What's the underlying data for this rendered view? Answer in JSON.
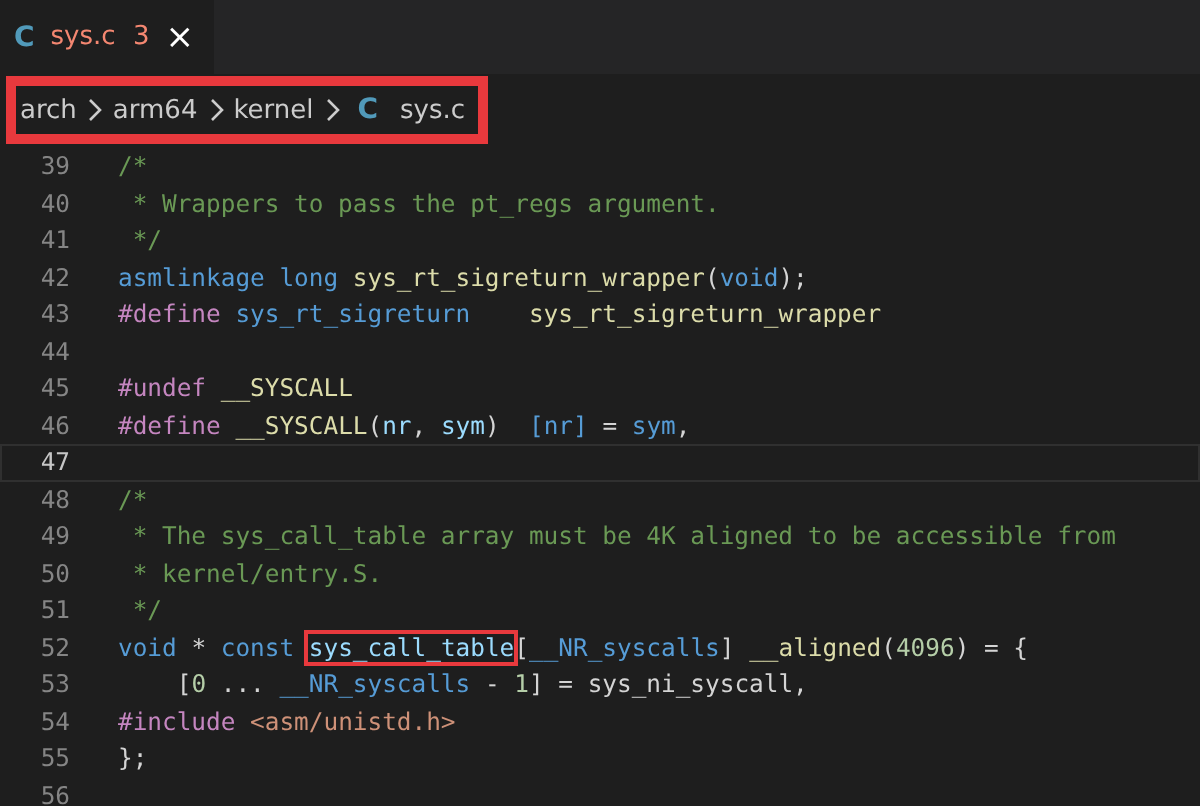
{
  "tab": {
    "icon": "C",
    "title": "sys.c",
    "problems": "3",
    "close": "×",
    "selected": true
  },
  "breadcrumb": {
    "highlighted": true,
    "items": [
      {
        "label": "arch"
      },
      {
        "label": "arm64"
      },
      {
        "label": "kernel"
      },
      {
        "label": "sys.c",
        "icon": "C"
      }
    ]
  },
  "lines": [
    {
      "number": "39",
      "current": false,
      "tokens": [
        {
          "text": "/*",
          "kind": "comment"
        }
      ]
    },
    {
      "number": "40",
      "current": false,
      "tokens": [
        {
          "text": " * Wrappers to pass the pt_regs argument.",
          "kind": "comment"
        }
      ]
    },
    {
      "number": "41",
      "current": false,
      "tokens": [
        {
          "text": " */",
          "kind": "comment"
        }
      ]
    },
    {
      "number": "42",
      "current": false,
      "tokens": [
        {
          "text": "asmlinkage long",
          "kind": "keyword"
        },
        {
          "text": " sys_rt_sigreturn_wrapper",
          "kind": "func"
        },
        {
          "text": "(",
          "kind": "plain"
        },
        {
          "text": "void",
          "kind": "keyword"
        },
        {
          "text": ");",
          "kind": "plain"
        }
      ]
    },
    {
      "number": "43",
      "current": false,
      "tokens": [
        {
          "text": "#define",
          "kind": "macro"
        },
        {
          "text": " sys_rt_sigreturn",
          "kind": "keyword"
        },
        {
          "text": "    sys_rt_sigreturn_wrapper",
          "kind": "func"
        }
      ]
    },
    {
      "number": "44",
      "current": false
    },
    {
      "number": "45",
      "current": false,
      "tokens": [
        {
          "text": "#undef",
          "kind": "macro"
        },
        {
          "text": " __SYSCALL",
          "kind": "func"
        }
      ]
    },
    {
      "number": "46",
      "current": false,
      "tokens": [
        {
          "text": "#define",
          "kind": "macro"
        },
        {
          "text": " __SYSCALL",
          "kind": "func"
        },
        {
          "text": "(",
          "kind": "plain"
        },
        {
          "text": "nr",
          "kind": "var"
        },
        {
          "text": ", ",
          "kind": "plain"
        },
        {
          "text": "sym",
          "kind": "var"
        },
        {
          "text": ")  ",
          "kind": "plain"
        },
        {
          "text": "[nr]",
          "kind": "keyword"
        },
        {
          "text": " = ",
          "kind": "plain"
        },
        {
          "text": "sym",
          "kind": "keyword"
        },
        {
          "text": ",",
          "kind": "plain"
        }
      ]
    },
    {
      "number": "47",
      "current": true
    },
    {
      "number": "48",
      "current": false,
      "tokens": [
        {
          "text": "/*",
          "kind": "comment"
        }
      ]
    },
    {
      "number": "49",
      "current": false,
      "tokens": [
        {
          "text": " * The sys_call_table array must be 4K aligned to be accessible from",
          "kind": "comment"
        }
      ]
    },
    {
      "number": "50",
      "current": false,
      "tokens": [
        {
          "text": " * kernel/entry.S.",
          "kind": "comment"
        }
      ]
    },
    {
      "number": "51",
      "current": false,
      "tokens": [
        {
          "text": " */",
          "kind": "comment"
        }
      ]
    },
    {
      "number": "52",
      "current": false,
      "tokens": [
        {
          "text": "void",
          "kind": "keyword"
        },
        {
          "text": " * ",
          "kind": "plain"
        },
        {
          "text": "const ",
          "kind": "keyword"
        },
        {
          "text": "sys_call_table",
          "kind": "var",
          "highlighted": true
        },
        {
          "text": "[",
          "kind": "plain"
        },
        {
          "text": "__NR_syscalls",
          "kind": "keyword"
        },
        {
          "text": "] ",
          "kind": "plain"
        },
        {
          "text": "__aligned",
          "kind": "func"
        },
        {
          "text": "(",
          "kind": "plain"
        },
        {
          "text": "4096",
          "kind": "number"
        },
        {
          "text": ") = {",
          "kind": "plain"
        }
      ]
    },
    {
      "number": "53",
      "current": false,
      "tokens": [
        {
          "text": "    [",
          "kind": "plain"
        },
        {
          "text": "0",
          "kind": "number"
        },
        {
          "text": " ... ",
          "kind": "plain"
        },
        {
          "text": "__NR_syscalls",
          "kind": "keyword"
        },
        {
          "text": " - ",
          "kind": "plain"
        },
        {
          "text": "1",
          "kind": "number"
        },
        {
          "text": "] = sys_ni_syscall,",
          "kind": "plain"
        }
      ]
    },
    {
      "number": "54",
      "current": false,
      "tokens": [
        {
          "text": "#include",
          "kind": "macro"
        },
        {
          "text": " <asm/unistd.h>",
          "kind": "string"
        }
      ]
    },
    {
      "number": "55",
      "current": false,
      "tokens": [
        {
          "text": "};",
          "kind": "plain"
        }
      ]
    },
    {
      "number": "56",
      "current": false
    }
  ]
}
